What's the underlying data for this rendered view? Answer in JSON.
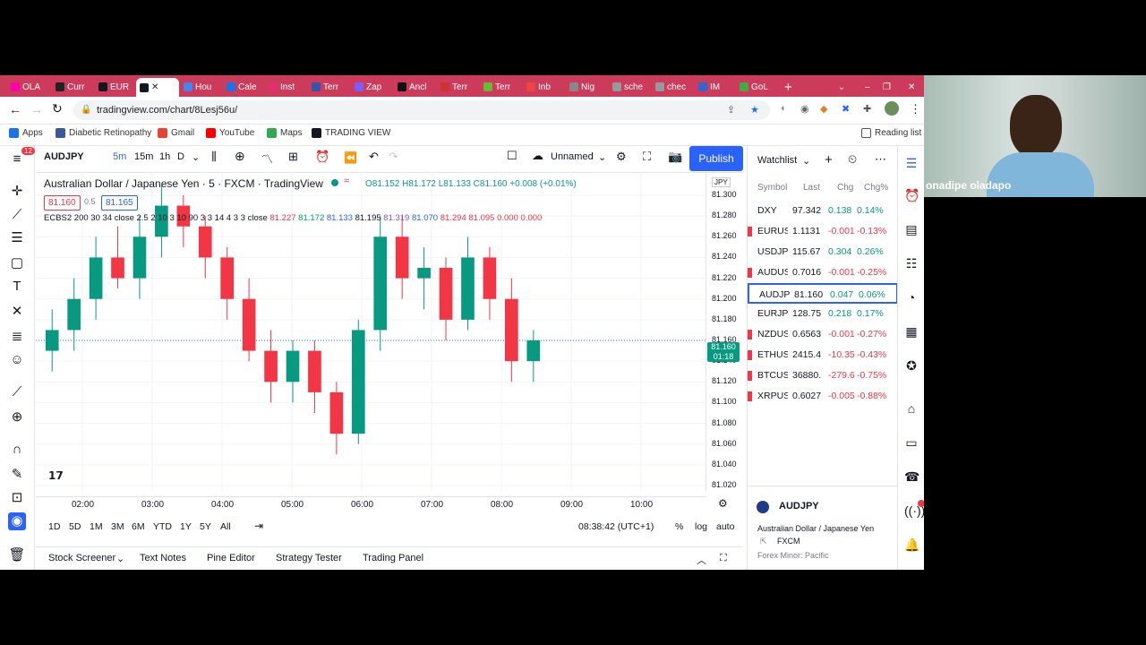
{
  "browser": {
    "tabs": [
      "OLA",
      "Curr",
      "EUR",
      "",
      "Hou",
      "Cale",
      "Inst",
      "Terr",
      "Zap",
      "Ancl",
      "Terr",
      "Terr",
      "Inb",
      "Nig",
      "sche",
      "chec",
      "IM",
      "GoL"
    ],
    "url": "tradingview.com/chart/8Lesj56u/",
    "bookmarks": [
      "Apps",
      "Diabetic Retinopathy",
      "Gmail",
      "YouTube",
      "Maps",
      "TRADING VIEW"
    ],
    "reading_list": "Reading list",
    "notification_badge": "12"
  },
  "toolbar": {
    "symbol": "AUDJPY",
    "intervals": [
      "5m",
      "15m",
      "1h",
      "D"
    ],
    "layout_name": "Unnamed",
    "publish": "Publish"
  },
  "legend": {
    "title": "Australian Dollar / Japanese Yen · 5 · FXCM · TradingView",
    "ohlc": "O81.152 H81.172 L81.133 C81.160 +0.008 (+0.01%)",
    "bid": "81.160",
    "spread": "0.5",
    "ask": "81.165",
    "indicator": "ECBS2 200 30 34 close 2.5 2 10 3 10 90 3 3 14 4 3 3 close",
    "indicator_values": [
      "81.227",
      "81.172",
      "81.133",
      "81.195",
      "81.319",
      "81.070",
      "81.294",
      "81.095",
      "0.000",
      "0.000"
    ]
  },
  "chart_data": {
    "type": "candlestick",
    "currency": "JPY",
    "current_price": "81.160",
    "countdown": "01:18",
    "y_ticks": [
      "81.300",
      "81.280",
      "81.260",
      "81.240",
      "81.220",
      "81.200",
      "81.180",
      "81.160",
      "81.140",
      "81.120",
      "81.100",
      "81.080",
      "81.060",
      "81.040",
      "81.020"
    ],
    "x_ticks": [
      "02:00",
      "03:00",
      "04:00",
      "05:00",
      "06:00",
      "07:00",
      "08:00",
      "09:00",
      "10:00"
    ],
    "ylim": [
      81.02,
      81.3
    ],
    "candles": [
      [
        81.15,
        81.19,
        81.13,
        81.17
      ],
      [
        81.17,
        81.22,
        81.15,
        81.2
      ],
      [
        81.2,
        81.26,
        81.18,
        81.24
      ],
      [
        81.24,
        81.27,
        81.21,
        81.22
      ],
      [
        81.22,
        81.28,
        81.2,
        81.26
      ],
      [
        81.26,
        81.31,
        81.24,
        81.29
      ],
      [
        81.29,
        81.3,
        81.25,
        81.27
      ],
      [
        81.27,
        81.28,
        81.22,
        81.24
      ],
      [
        81.24,
        81.25,
        81.18,
        81.2
      ],
      [
        81.2,
        81.22,
        81.14,
        81.15
      ],
      [
        81.15,
        81.17,
        81.1,
        81.12
      ],
      [
        81.12,
        81.16,
        81.1,
        81.15
      ],
      [
        81.15,
        81.16,
        81.09,
        81.11
      ],
      [
        81.11,
        81.12,
        81.05,
        81.07
      ],
      [
        81.07,
        81.18,
        81.06,
        81.17
      ],
      [
        81.17,
        81.28,
        81.15,
        81.26
      ],
      [
        81.26,
        81.28,
        81.2,
        81.22
      ],
      [
        81.22,
        81.25,
        81.19,
        81.23
      ],
      [
        81.23,
        81.24,
        81.16,
        81.18
      ],
      [
        81.18,
        81.26,
        81.17,
        81.24
      ],
      [
        81.24,
        81.25,
        81.18,
        81.2
      ],
      [
        81.2,
        81.22,
        81.12,
        81.14
      ],
      [
        81.14,
        81.17,
        81.12,
        81.16
      ]
    ],
    "grid": true
  },
  "range": {
    "periods": [
      "1D",
      "5D",
      "1M",
      "3M",
      "6M",
      "YTD",
      "1Y",
      "5Y",
      "All"
    ],
    "clock": "08:38:42 (UTC+1)",
    "percent": "%",
    "log": "log",
    "auto": "auto"
  },
  "bottom_tabs": [
    "Stock Screener",
    "Text Notes",
    "Pine Editor",
    "Strategy Tester",
    "Trading Panel"
  ],
  "watchlist": {
    "title": "Watchlist",
    "headers": [
      "Symbol",
      "Last",
      "Chg",
      "Chg%"
    ],
    "rows": [
      {
        "sym": "DXY",
        "last": "97.342",
        "chg": "0.138",
        "pct": "0.14%",
        "dir": "up"
      },
      {
        "sym": "EURUSD",
        "last": "1.1131",
        "chg": "-0.001",
        "pct": "-0.13%",
        "dir": "down"
      },
      {
        "sym": "USDJPY",
        "last": "115.67",
        "chg": "0.304",
        "pct": "0.26%",
        "dir": "up"
      },
      {
        "sym": "AUDUSD",
        "last": "0.7016",
        "chg": "-0.001",
        "pct": "-0.25%",
        "dir": "down"
      },
      {
        "sym": "AUDJPY",
        "last": "81.160",
        "chg": "0.047",
        "pct": "0.06%",
        "dir": "up"
      },
      {
        "sym": "EURJPY",
        "last": "128.75",
        "chg": "0.218",
        "pct": "0.17%",
        "dir": "up"
      },
      {
        "sym": "NZDUSD",
        "last": "0.6563",
        "chg": "-0.001",
        "pct": "-0.27%",
        "dir": "down"
      },
      {
        "sym": "ETHUSD",
        "last": "2415.4",
        "chg": "-10.35",
        "pct": "-0.43%",
        "dir": "down"
      },
      {
        "sym": "BTCUSD",
        "last": "36880.",
        "chg": "-279.6",
        "pct": "-0.75%",
        "dir": "down"
      },
      {
        "sym": "XRPUSD",
        "last": "0.6027",
        "chg": "-0.005",
        "pct": "-0.88%",
        "dir": "down"
      }
    ],
    "detail": {
      "symbol": "AUDJPY",
      "name": "Australian Dollar / Japanese Yen",
      "exchange": "FXCM",
      "category": "Forex Minor: Pacific"
    }
  },
  "webcam": {
    "name": "onadipe oladapo"
  },
  "colors": {
    "up": "#089981",
    "down": "#f23645",
    "accent": "#2962ff",
    "tabstrip": "#cc3b5a"
  }
}
